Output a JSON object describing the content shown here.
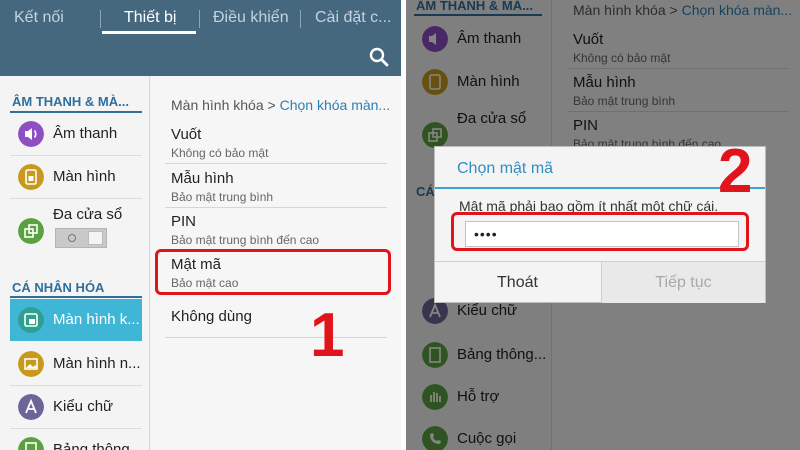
{
  "left": {
    "tabs": [
      "Kết nối",
      "Thiết bị",
      "Điều khiển",
      "Cài đặt c..."
    ],
    "active_tab": "Thiết bị",
    "sidebar": {
      "section1": "ÂM THANH & MÀ...",
      "items1": [
        {
          "label": "Âm thanh",
          "icon": "speaker-icon"
        },
        {
          "label": "Màn hình",
          "icon": "display-icon"
        },
        {
          "label": "Đa cửa sổ",
          "icon": "multi-window-icon"
        }
      ],
      "section2": "CÁ NHÂN HÓA",
      "items2": [
        {
          "label": "Màn hình k...",
          "icon": "lock-screen-icon",
          "selected": true
        },
        {
          "label": "Màn hình n...",
          "icon": "wallpaper-icon"
        },
        {
          "label": "Kiểu chữ",
          "icon": "font-icon"
        },
        {
          "label": "Bảng thông...",
          "icon": "notification-panel-icon"
        }
      ]
    },
    "content": {
      "breadcrumb_parent": "Màn hình khóa",
      "breadcrumb_current": "Chọn khóa màn...",
      "options": [
        {
          "title": "Vuốt",
          "subtitle": "Không có bảo mật"
        },
        {
          "title": "Mẫu hình",
          "subtitle": "Bảo mật trung bình"
        },
        {
          "title": "PIN",
          "subtitle": "Bảo mật trung bình đến cao"
        },
        {
          "title": "Mật mã",
          "subtitle": "Bảo mật cao"
        },
        {
          "title": "Không dùng",
          "subtitle": ""
        }
      ]
    },
    "step_number": "1"
  },
  "right": {
    "sidebar": {
      "section1": "ÂM THANH & MÀ...",
      "items": [
        "Âm thanh",
        "Màn hình",
        "Đa cửa sổ",
        "Kiểu chữ",
        "Bảng thông...",
        "Hỗ trợ",
        "Cuộc gọi"
      ],
      "section2_partial": "CÁ"
    },
    "content": {
      "breadcrumb_parent": "Màn hình khóa",
      "breadcrumb_current": "Chọn khóa màn...",
      "options": [
        {
          "title": "Vuốt",
          "subtitle": "Không có bảo mật"
        },
        {
          "title": "Mẫu hình",
          "subtitle": "Bảo mật trung bình"
        },
        {
          "title": "PIN",
          "subtitle": "Bảo mật trung bình đến cao"
        }
      ]
    },
    "dialog": {
      "title": "Chọn mật mã",
      "message": "Mật mã phải bao gồm ít nhất một chữ cái.",
      "input_value": "••••",
      "cancel_label": "Thoát",
      "next_label": "Tiếp tục"
    },
    "step_number": "2"
  },
  "colors": {
    "topbar": "#45687f",
    "accent": "#2e6f9e",
    "selected": "#3fb6d6",
    "highlight": "#e0141a",
    "dialog_title": "#2f8fbf"
  }
}
